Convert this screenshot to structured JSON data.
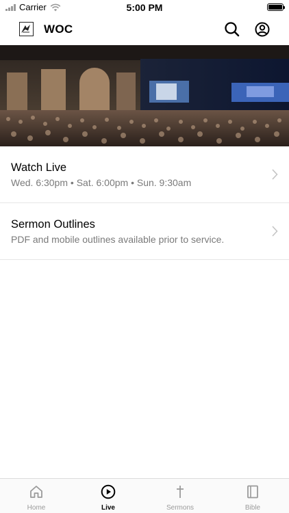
{
  "status_bar": {
    "carrier": "Carrier",
    "time": "5:00 PM"
  },
  "header": {
    "title": "WOC",
    "icons": [
      "search-icon",
      "account-icon"
    ]
  },
  "hero": {
    "description_icon": "congregation-photo"
  },
  "list": [
    {
      "title": "Watch Live",
      "subtitle": "Wed. 6:30pm • Sat. 6:00pm • Sun. 9:30am"
    },
    {
      "title": "Sermon Outlines",
      "subtitle": "PDF and mobile outlines available prior to service."
    }
  ],
  "tabs": [
    {
      "label": "Home",
      "icon": "home-icon",
      "active": false
    },
    {
      "label": "Live",
      "icon": "play-circle-icon",
      "active": true
    },
    {
      "label": "Sermons",
      "icon": "cross-icon",
      "active": false
    },
    {
      "label": "Bible",
      "icon": "book-icon",
      "active": false
    }
  ],
  "colors": {
    "active": "#000000",
    "inactive": "#9a9a9a",
    "divider": "#e6e6e6",
    "subtitle": "#7a7a7a"
  }
}
